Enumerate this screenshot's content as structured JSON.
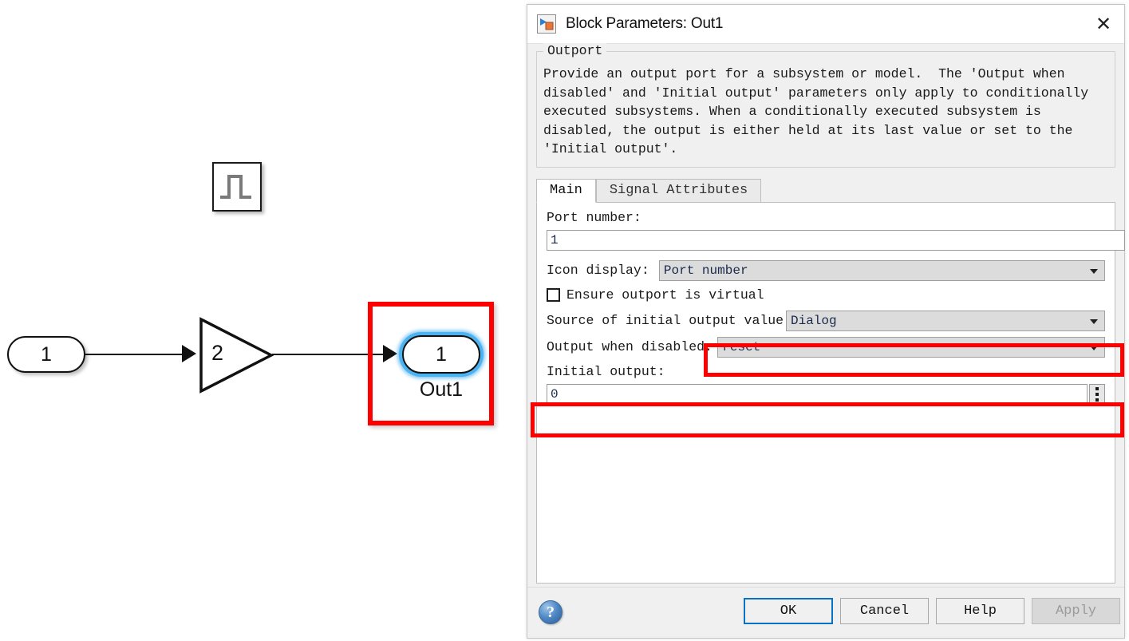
{
  "canvas": {
    "pulse_block": {
      "name": "pulse-generator-block"
    },
    "inport_block": {
      "label": "1"
    },
    "gain_block": {
      "label": "2"
    },
    "outport_block": {
      "port_label": "1",
      "name_label": "Out1"
    }
  },
  "dialog": {
    "title": "Block Parameters: Out1",
    "icon": "outport-block-icon",
    "close_label": "✕",
    "description": {
      "group_title": "Outport",
      "text": "Provide an output port for a subsystem or model.  The 'Output when\ndisabled' and 'Initial output' parameters only apply to conditionally\nexecuted subsystems. When a conditionally executed subsystem is\ndisabled, the output is either held at its last value or set to the\n'Initial output'."
    },
    "tabs": [
      {
        "label": "Main",
        "active": true
      },
      {
        "label": "Signal Attributes",
        "active": false
      }
    ],
    "fields": {
      "port_number_label": "Port number:",
      "port_number_value": "1",
      "icon_display_label": "Icon display:",
      "icon_display_value": "Port number",
      "ensure_virtual_label": "Ensure outport is virtual",
      "ensure_virtual_checked": false,
      "source_initial_label": "Source of initial output value:",
      "source_initial_value": "Dialog",
      "output_disabled_label": "Output when disabled:",
      "output_disabled_value": "reset",
      "initial_output_label": "Initial output:",
      "initial_output_value": "0"
    },
    "footer": {
      "help_glyph": "?",
      "ok_label": "OK",
      "cancel_label": "Cancel",
      "help_label": "Help",
      "apply_label": "Apply"
    }
  },
  "annotations": {
    "color": "#ff0000",
    "boxes": [
      "outport-block-on-canvas",
      "output-when-disabled-combo",
      "initial-output-field"
    ]
  }
}
